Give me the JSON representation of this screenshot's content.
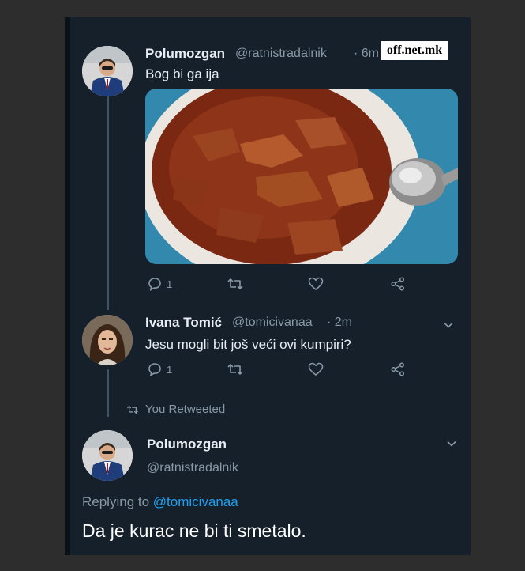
{
  "watermark": "off.net.mk",
  "tweet1": {
    "name": "Polumozgan",
    "handle": "@ratnistradalnik",
    "time": "· 6m",
    "text": "Bog bi ga ija",
    "reply_count": "1",
    "image_icon": "stew-photo"
  },
  "tweet2": {
    "name": "Ivana Tomić",
    "handle": "@tomicivanaa",
    "time": "· 2m",
    "text": "Jesu mogli bit još veći ovi kumpiri?",
    "reply_count": "1"
  },
  "retweet_indicator": "You Retweeted",
  "tweet3": {
    "name": "Polumozgan",
    "handle": "@ratnistradalnik",
    "replying_label": "Replying to",
    "replying_mention": "@tomicivanaa",
    "text": "Da je kurac ne bi ti smetalo."
  },
  "colors": {
    "background": "#15202b",
    "accent": "#1da1f2",
    "muted": "#8899a6"
  }
}
